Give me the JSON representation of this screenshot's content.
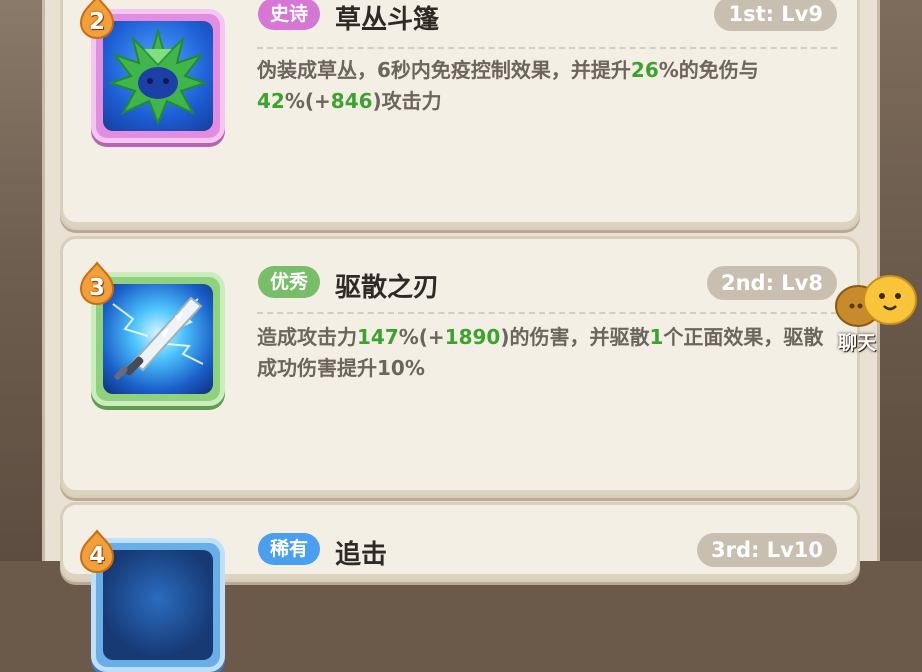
{
  "skills": [
    {
      "badge": "2",
      "rarity": "史诗",
      "name": "草丛斗篷",
      "level": "1st: Lv9",
      "icon": "bush-cloak-icon",
      "desc": [
        {
          "t": "伪装成草丛，6秒内免疫控制效果，并提升",
          "hl": false
        },
        {
          "t": "26",
          "hl": true
        },
        {
          "t": "%的免伤与",
          "hl": false
        },
        {
          "t": "42",
          "hl": true
        },
        {
          "t": "%(+",
          "hl": false
        },
        {
          "t": "846",
          "hl": true
        },
        {
          "t": ")攻击力",
          "hl": false
        }
      ]
    },
    {
      "badge": "3",
      "rarity": "优秀",
      "name": "驱散之刃",
      "level": "2nd: Lv8",
      "icon": "lightning-blade-icon",
      "desc": [
        {
          "t": "造成攻击力",
          "hl": false
        },
        {
          "t": "147",
          "hl": true
        },
        {
          "t": "%(+",
          "hl": false
        },
        {
          "t": "1890",
          "hl": true
        },
        {
          "t": ")的伤害，并驱散",
          "hl": false
        },
        {
          "t": "1",
          "hl": true
        },
        {
          "t": "个正面效果，驱散成功伤害提升10%",
          "hl": false
        }
      ]
    },
    {
      "badge": "4",
      "rarity": "稀有",
      "name": "追击",
      "level": "3rd: Lv10",
      "icon": "pursuit-icon",
      "desc": []
    }
  ],
  "chat": {
    "label": "聊天",
    "icon": "chat-bubble-icon"
  },
  "colors": {
    "epic": "#d777d5",
    "excellent": "#78bd68",
    "rare": "#4a9ff0",
    "highlight": "#3da32f"
  }
}
